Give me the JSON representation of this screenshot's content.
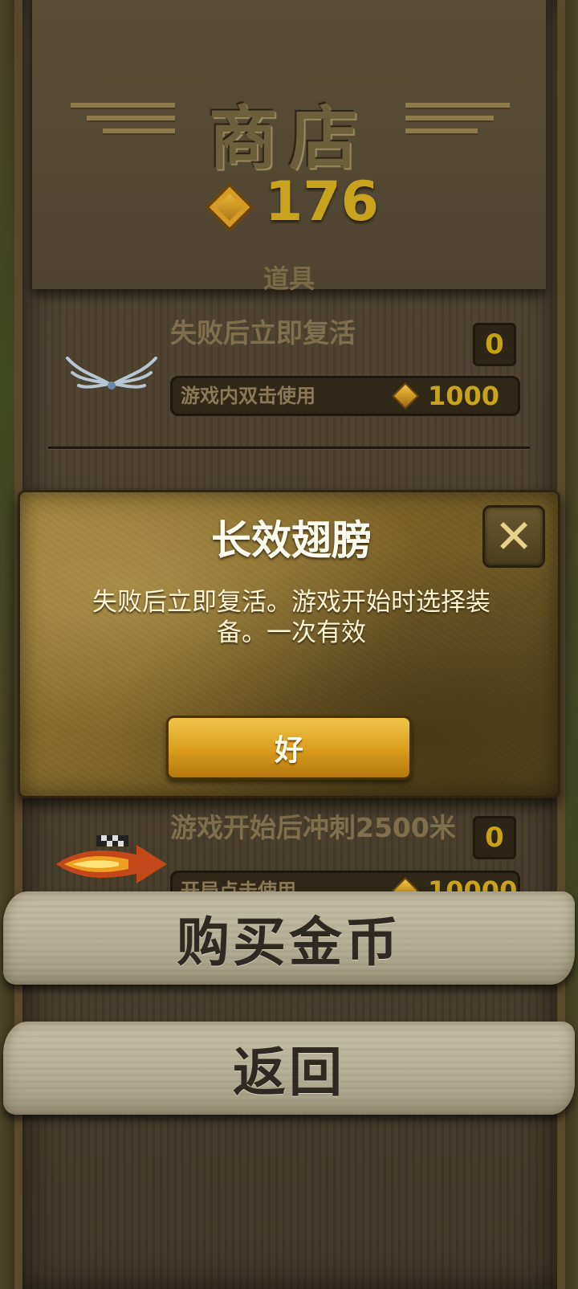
{
  "shop": {
    "title": "商店",
    "coins": "176",
    "section": "道具"
  },
  "items": [
    {
      "title": "失败后立即复活",
      "count": "0",
      "usage": "游戏内双击使用",
      "price": "1000",
      "icon": "wings-icon"
    },
    {
      "title": "游戏开始后冲刺2500米",
      "count": "0",
      "usage": "开局点击使用",
      "price": "10000",
      "icon": "boost-icon"
    }
  ],
  "modal": {
    "title": "长效翅膀",
    "description": "失败后立即复活。游戏开始时选择装备。一次有效",
    "ok_label": "好",
    "close_label": "✕"
  },
  "buttons": {
    "buy_coins": "购买金币",
    "back": "返回"
  },
  "colors": {
    "gold": "#c9a31e",
    "panel": "#4a402c",
    "parchment": "#b3ad93"
  }
}
